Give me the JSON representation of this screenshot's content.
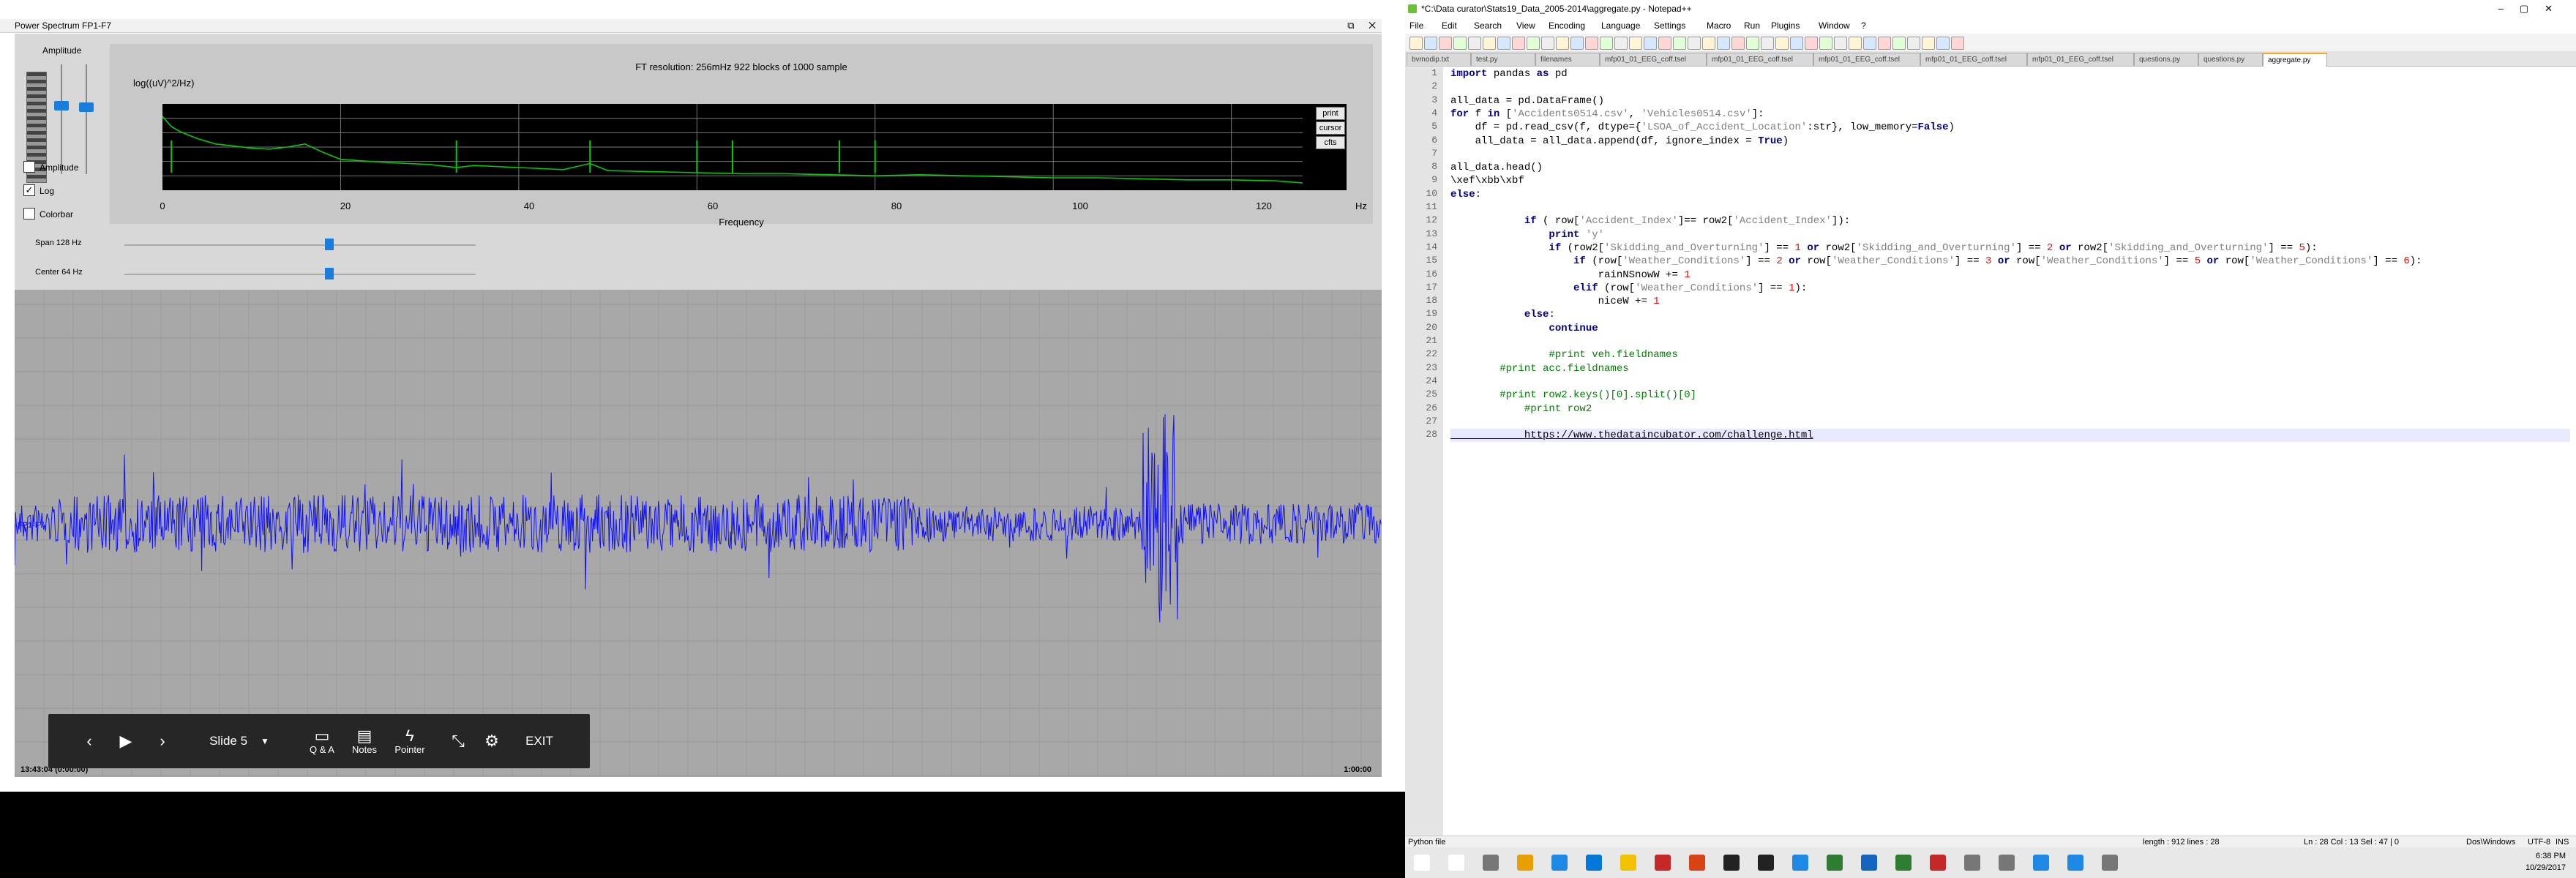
{
  "left_window": {
    "title": "Power Spectrum FP1-F7",
    "window_buttons": "⧉ ✕",
    "amplitude_label": "Amplitude",
    "checkboxes": [
      {
        "label": "Amplitude",
        "checked": false
      },
      {
        "label": "Log",
        "checked": true
      },
      {
        "label": "Colorbar",
        "checked": false
      }
    ],
    "chart": {
      "info": "FT resolution: 256mHz   922 blocks of 1000 sample",
      "y_unit": "log((uV)^2/Hz)",
      "x_ticks": [
        "0",
        "20",
        "40",
        "60",
        "80",
        "100",
        "120"
      ],
      "x_unit": "Hz",
      "x_label": "Frequency",
      "side_buttons": [
        "print",
        "cursor",
        "cfts"
      ]
    },
    "span_label": "Span 128 Hz",
    "center_label": "Center 64 Hz",
    "span_level": 0.57,
    "center_level": 0.57,
    "eeg": {
      "channel_label": "FP1-F7",
      "time_start": "13:43:04 (0:00:00)",
      "time_end": "1:00:00"
    }
  },
  "chart_data": {
    "type": "line",
    "title": "",
    "xlabel": "Frequency",
    "ylabel": "log((uV)^2/Hz)",
    "xlim": [
      0,
      128
    ],
    "x_unit": "Hz",
    "series": [
      {
        "color": "#00cc00",
        "x": [
          0,
          1,
          2,
          4,
          6,
          8,
          10,
          12,
          14,
          16,
          18,
          20,
          25,
          30,
          33,
          35,
          40,
          45,
          48,
          50,
          55,
          60,
          65,
          70,
          75,
          80,
          85,
          90,
          95,
          100,
          105,
          110,
          115,
          120,
          125,
          128
        ],
        "y": [
          3,
          2,
          1.5,
          0.8,
          0.3,
          0.1,
          -0.1,
          -0.2,
          0,
          0.3,
          -0.5,
          -1.2,
          -1.5,
          -1.7,
          -2.0,
          -1.8,
          -2.0,
          -2.2,
          -1.6,
          -2.3,
          -2.4,
          -2.5,
          -2.6,
          -2.6,
          -2.7,
          -2.8,
          -2.7,
          -2.8,
          -2.9,
          -3.0,
          -3.0,
          -3.1,
          -3.2,
          -3.2,
          -3.3,
          -3.5
        ]
      }
    ],
    "spikes_x": [
      1,
      33,
      48,
      60,
      64,
      76,
      80
    ]
  },
  "slide_bar": {
    "slide_label": "Slide 5",
    "qa_label": "Q & A",
    "notes_label": "Notes",
    "pointer_label": "Pointer",
    "exit_label": "EXIT"
  },
  "npp": {
    "title": "*C:\\Data curator\\Stats19_Data_2005-2014\\aggregate.py - Notepad++",
    "menu": [
      "File",
      "Edit",
      "Search",
      "View",
      "Encoding",
      "Language",
      "Settings",
      "Macro",
      "Run",
      "Plugins",
      "Window",
      "?"
    ],
    "tabs": [
      "bvmodip.txt",
      "test.py",
      "filenames",
      "mfp01_01_EEG_coff.tsel",
      "mfp01_01_EEG_coff.tsel",
      "mfp01_01_EEG_coff.tsel",
      "mfp01_01_EEG_coff.tsel",
      "mfp01_01_EEG_coff.tsel",
      "questions.py",
      "questions.py",
      "aggregate.py"
    ],
    "line_numbers": [
      "1",
      "2",
      "3",
      "4",
      "5",
      "6",
      "7",
      "8",
      "9",
      "10",
      "11",
      "12",
      "13",
      "14",
      "15",
      "16",
      "17",
      "18",
      "19",
      "20",
      "21",
      "22",
      "23",
      "24",
      "25",
      "26",
      "27",
      "28"
    ],
    "code_lines": [
      "import pandas as pd",
      "",
      "all_data = pd.DataFrame()",
      "for f in ['Accidents0514.csv', 'Vehicles0514.csv']:",
      "    df = pd.read_csv(f, dtype={'LSOA_of_Accident_Location':str}, low_memory=False)",
      "    all_data = all_data.append(df, ignore_index = True)",
      "",
      "all_data.head()",
      "\\xef\\xbb\\xbf",
      "else:",
      "",
      "            if ( row['Accident_Index']== row2['Accident_Index']):",
      "                print 'y'",
      "                if (row2['Skidding_and_Overturning'] == 1 or row2['Skidding_and_Overturning'] == 2 or row2['Skidding_and_Overturning'] == 5):",
      "                    if (row['Weather_Conditions'] == 2 or row['Weather_Conditions'] == 3 or row['Weather_Conditions'] == 5 or row['Weather_Conditions'] == 6):",
      "                        rainNSnowW += 1",
      "                    elif (row['Weather_Conditions'] == 1):",
      "                        niceW += 1",
      "            else:",
      "                continue",
      "",
      "                #print veh.fieldnames",
      "        #print acc.fieldnames",
      "",
      "        #print row2.keys()[0].split()[0]",
      "            #print row2",
      "",
      "            https://www.thedataincubator.com/challenge.html"
    ],
    "status_left": "Python file",
    "status_length": "length : 912    lines : 28",
    "status_pos": "Ln : 28    Col : 13    Sel : 47 | 0",
    "status_eol": "Dos\\Windows",
    "status_enc": "UTF-8",
    "status_ins": "INS"
  },
  "taskbar": {
    "time": "6:38 PM",
    "date": "10/29/2017"
  }
}
